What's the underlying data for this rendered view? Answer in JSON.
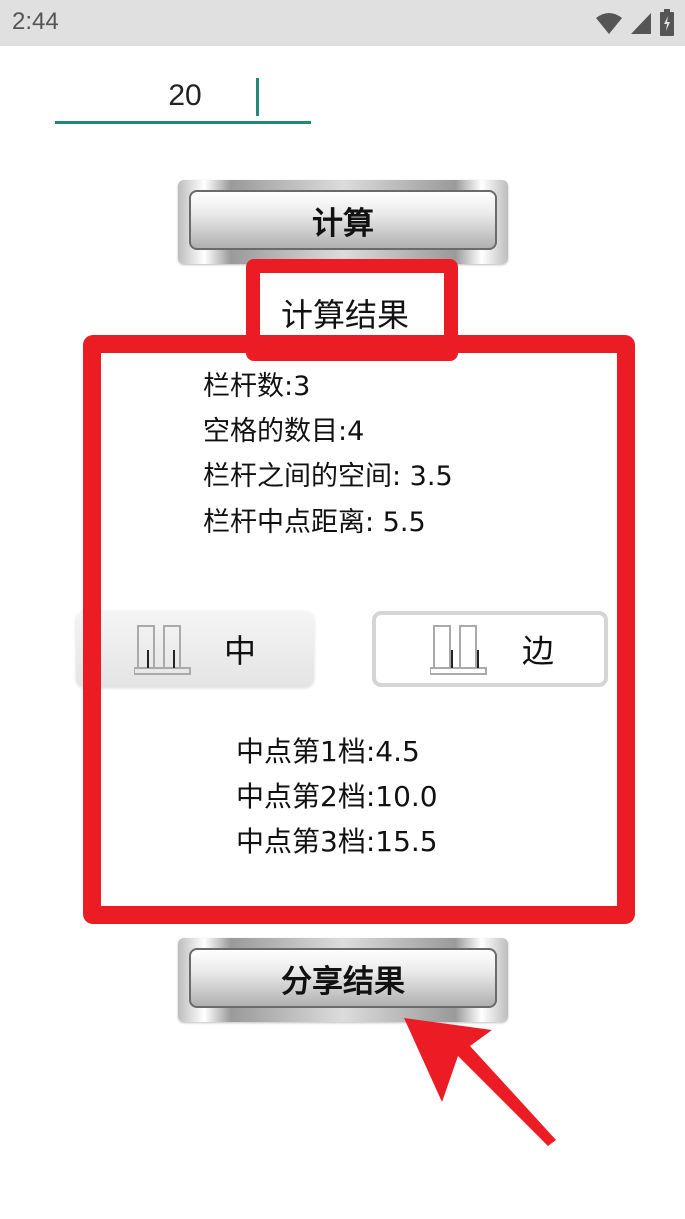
{
  "status_bar": {
    "time": "2:44",
    "icons": [
      "wifi-icon",
      "signal-icon",
      "battery-icon"
    ]
  },
  "input": {
    "value": "20"
  },
  "buttons": {
    "calculate": "计算",
    "share": "分享结果"
  },
  "result": {
    "title": "计算结果",
    "lines": [
      "栏杆数:3",
      "空格的数目:4",
      "栏杆之间的空间: 3.5",
      "栏杆中点距离: 5.5"
    ]
  },
  "toggles": {
    "center": "中",
    "edge": "边"
  },
  "steps": [
    "中点第1档:4.5",
    "中点第2档:10.0",
    "中点第3档:15.5"
  ],
  "colors": {
    "annotation_red": "#ec1c24",
    "accent_teal": "#1f8a78"
  }
}
